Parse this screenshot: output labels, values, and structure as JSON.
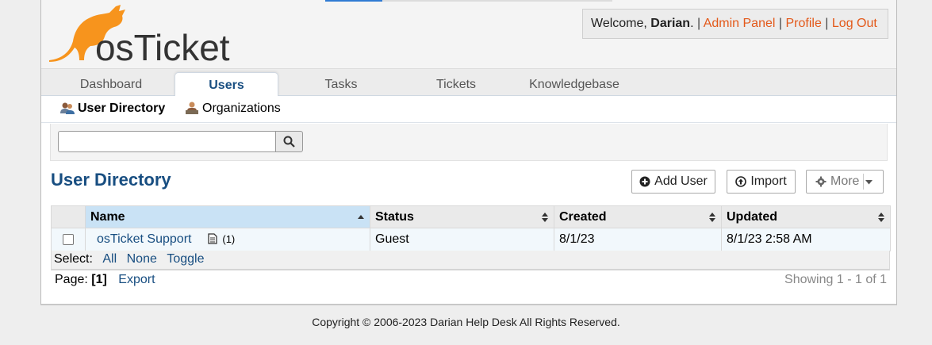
{
  "brand": {
    "logo_text": "osTicket",
    "accent": "#f7941d",
    "link_color": "#e3591a",
    "primary": "#184e81"
  },
  "welcome": {
    "prefix": "Welcome, ",
    "user": "Darian",
    "suffix": ".",
    "sep": "|",
    "links": [
      "Admin Panel",
      "Profile",
      "Log Out"
    ]
  },
  "nav": {
    "tabs": [
      "Dashboard",
      "Users",
      "Tasks",
      "Tickets",
      "Knowledgebase"
    ],
    "active": "Users"
  },
  "subnav": {
    "items": [
      "User Directory",
      "Organizations"
    ],
    "active": "User Directory"
  },
  "search": {
    "value": "",
    "placeholder": "",
    "button_icon": "search-icon"
  },
  "page": {
    "title": "User Directory"
  },
  "actions": {
    "add_user": "Add User",
    "import": "Import",
    "more": "More"
  },
  "table": {
    "columns": [
      "Name",
      "Status",
      "Created",
      "Updated"
    ],
    "rows": [
      {
        "name": "osTicket Support",
        "notes": "(1)",
        "status": "Guest",
        "created": "8/1/23",
        "updated": "8/1/23 2:58 AM"
      }
    ]
  },
  "select": {
    "label": "Select:",
    "links": [
      "All",
      "None",
      "Toggle"
    ]
  },
  "pager": {
    "label": "Page:",
    "current": "[1]",
    "export": "Export",
    "showing": "Showing 1 - 1 of 1"
  },
  "footer": {
    "text": "Copyright © 2006-2023 Darian Help Desk All Rights Reserved."
  }
}
